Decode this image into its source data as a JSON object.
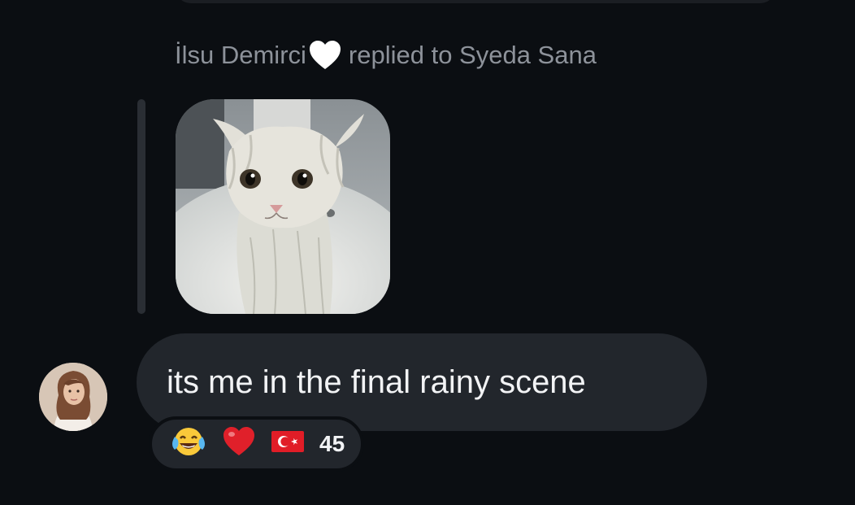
{
  "reply_header": {
    "sender": "İlsu Demirci",
    "heart_icon": "white-heart-icon",
    "action": "replied to Syeda Sana"
  },
  "reply_image": {
    "icon": "wet-kitten-photo"
  },
  "message": {
    "text": "its me in the final rainy scene",
    "avatar_icon": "profile-photo-avatar"
  },
  "reactions": {
    "items": [
      {
        "icon": "tears-of-joy-emoji"
      },
      {
        "icon": "red-heart-emoji"
      },
      {
        "icon": "turkey-flag-emoji"
      }
    ],
    "count": "45"
  },
  "colors": {
    "background": "#0b0e12",
    "bubble": "#22262c",
    "meta_text": "#8d929a",
    "text": "#f2f3f5"
  }
}
